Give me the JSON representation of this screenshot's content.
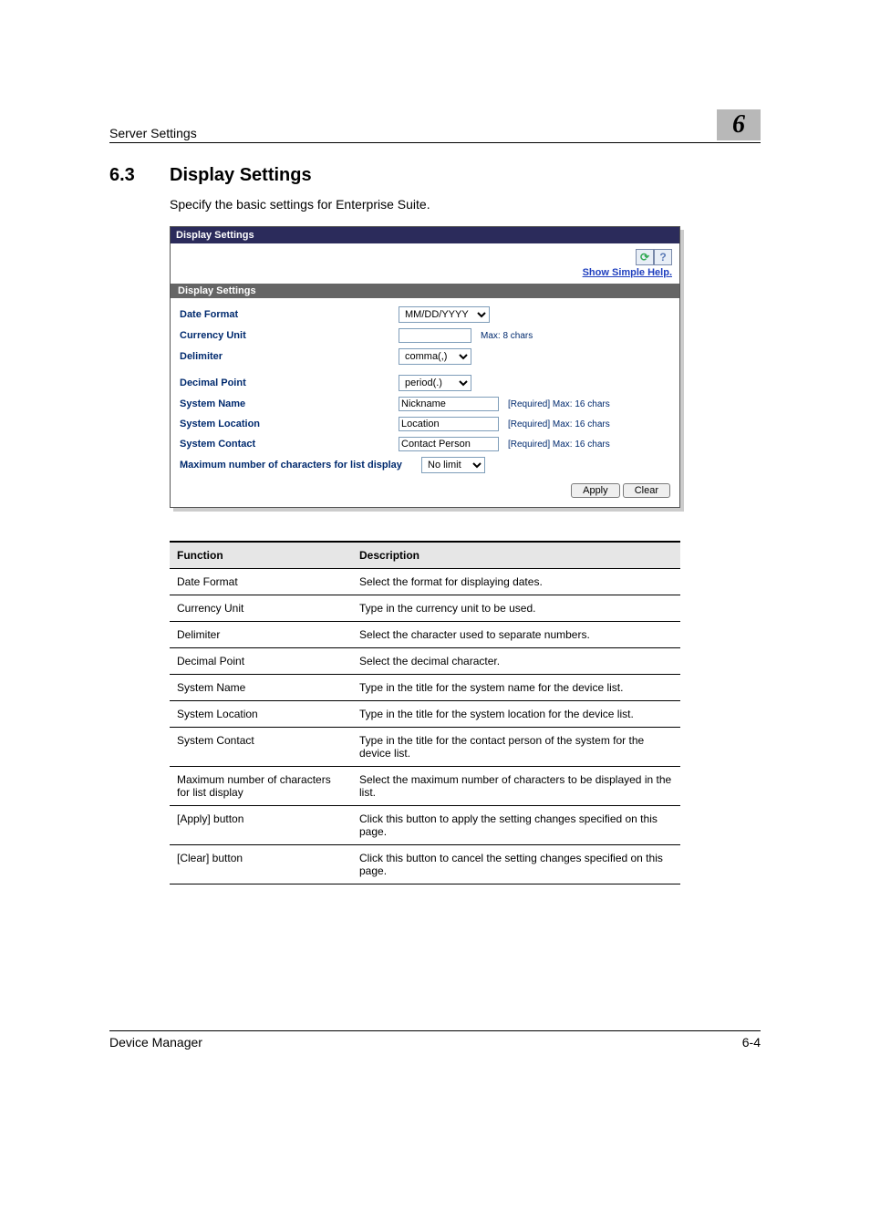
{
  "header": {
    "section": "Server Settings",
    "chapter": "6"
  },
  "section": {
    "number": "6.3",
    "title": "Display Settings",
    "intro": "Specify the basic settings for Enterprise Suite."
  },
  "shot": {
    "titlebar": "Display Settings",
    "help_link": "Show Simple Help.",
    "section_header": "Display Settings",
    "date_format": {
      "label": "Date Format",
      "value": "MM/DD/YYYY"
    },
    "currency": {
      "label": "Currency Unit",
      "note": "Max: 8 chars"
    },
    "delimiter": {
      "label": "Delimiter",
      "value": "comma(,)"
    },
    "decimal": {
      "label": "Decimal Point",
      "value": "period(.)"
    },
    "system_name": {
      "label": "System Name",
      "value": "Nickname",
      "note": "[Required] Max: 16 chars"
    },
    "system_location": {
      "label": "System Location",
      "value": "Location",
      "note": "[Required] Max: 16 chars"
    },
    "system_contact": {
      "label": "System Contact",
      "value": "Contact Person",
      "note": "[Required] Max: 16 chars"
    },
    "max_chars": {
      "label": "Maximum number of characters for list display",
      "value": "No limit"
    },
    "buttons": {
      "apply": "Apply",
      "clear": "Clear"
    }
  },
  "table": {
    "head": {
      "fn": "Function",
      "desc": "Description"
    },
    "rows": [
      {
        "fn": "Date Format",
        "desc": "Select the format for displaying dates."
      },
      {
        "fn": "Currency Unit",
        "desc": "Type in the currency unit to be used."
      },
      {
        "fn": "Delimiter",
        "desc": "Select the character used to separate numbers."
      },
      {
        "fn": "Decimal Point",
        "desc": "Select the decimal character."
      },
      {
        "fn": "System Name",
        "desc": "Type in the title for the system name for the device list."
      },
      {
        "fn": "System Location",
        "desc": "Type in the title for the system location for the device list."
      },
      {
        "fn": "System Contact",
        "desc": "Type in the title for the contact person of the system for the device list."
      },
      {
        "fn": "Maximum number of characters for list display",
        "desc": "Select the maximum number of characters to be displayed in the list."
      },
      {
        "fn": "[Apply] button",
        "desc": "Click this button to apply the setting changes specified on this page."
      },
      {
        "fn": "[Clear] button",
        "desc": "Click this button to cancel the setting changes specified on this page."
      }
    ]
  },
  "footer": {
    "left": "Device Manager",
    "right": "6-4"
  }
}
